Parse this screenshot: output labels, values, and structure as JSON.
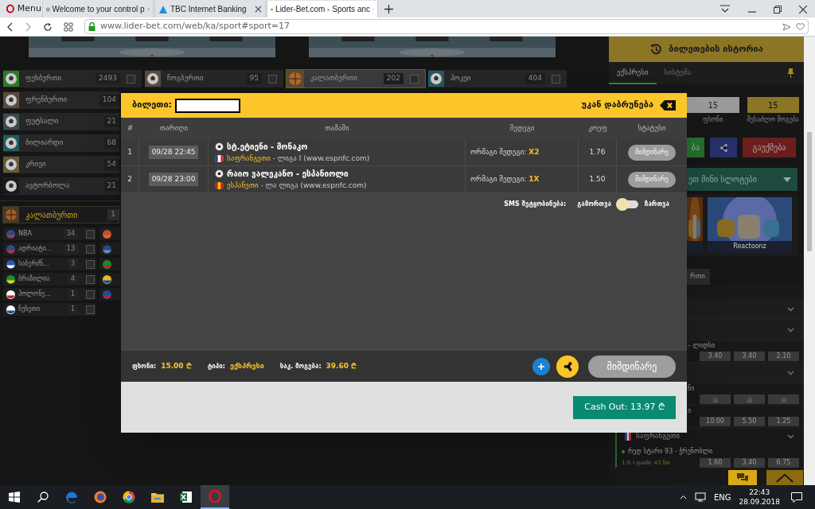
{
  "browser": {
    "menu": "Menu",
    "tabs": [
      {
        "label": "Welcome to your control p",
        "selected": false
      },
      {
        "label": "TBC Internet Banking",
        "selected": false
      },
      {
        "label": "Lider-Bet.com - Sports anc",
        "selected": true
      }
    ],
    "address": "www.lider-bet.com/web/ka/sport#sport=17"
  },
  "sports_top": [
    {
      "name": "ფეხბურთი",
      "count": "2493",
      "checked": false,
      "selected": false
    },
    {
      "name": "ჩოგბურთი",
      "count": "95",
      "checked": false,
      "selected": false
    },
    {
      "name": "კალათბურთი",
      "count": "202",
      "checked": false,
      "selected": true
    },
    {
      "name": "ჰოკეი",
      "count": "404",
      "checked": false,
      "selected": false
    }
  ],
  "sports_more": [
    {
      "name": "ფრენბურთი",
      "count": "104"
    },
    {
      "name": "ფუტსალი",
      "count": "21"
    },
    {
      "name": "ბილიარდი",
      "count": "68"
    },
    {
      "name": "კრივი",
      "count": "54"
    },
    {
      "name": "ავტორბოლა",
      "count": "21"
    }
  ],
  "active_sport": {
    "name": "კალათბურთი",
    "count": "1"
  },
  "leagues": [
    {
      "name": "NBA",
      "count": "34",
      "checked": false
    },
    {
      "name": "ადრიატი...",
      "count": "13",
      "checked": false
    },
    {
      "name": "საბერძნ...",
      "count": "3",
      "checked": false
    },
    {
      "name": "ბრაზილია",
      "count": "4",
      "checked": false
    },
    {
      "name": "პოლონე...",
      "count": "1",
      "checked": false
    },
    {
      "name": "ჩეხეთი",
      "count": "1",
      "checked": false
    }
  ],
  "betslip": {
    "history_button": "ბილეთების ისტორია",
    "tabs": [
      {
        "label": "ექსპრესი",
        "selected": true
      },
      {
        "label": "სისტემა",
        "selected": false
      }
    ],
    "stake": {
      "value": "15",
      "label": "ფსონი"
    },
    "possible_win": {
      "value": "15",
      "label": "შესაძლო მოგება"
    },
    "place_button": "ბა",
    "cancel_button": "გაუქმება"
  },
  "mini_slots": {
    "title": "ეთ მინი სლოტები",
    "games": [
      {
        "kind": "picture"
      },
      {
        "kind": "picture",
        "label": "Reactoonz"
      }
    ]
  },
  "events_tab": "რთი",
  "events": [
    {
      "kind": "collapsed"
    },
    {
      "kind": "collapsed"
    },
    {
      "kind": "match",
      "title": "– ლიდსი",
      "odds": [
        "3.40",
        "3.40",
        "2.10"
      ]
    },
    {
      "kind": "collapsed"
    },
    {
      "kind": "locked",
      "title": "ნი"
    },
    {
      "kind": "match",
      "title": "ი",
      "odds": [
        "10.00",
        "5.50",
        "1.25"
      ]
    },
    {
      "kind": "country",
      "title": "საფრანგეთი"
    },
    {
      "kind": "live",
      "title": "რედ სტარი 93 - ჭრენობლი",
      "score": "1:0",
      "period": "I ტაიმი",
      "minute": "43 წთ",
      "odds": [
        "1.60",
        "3.40",
        "6.75"
      ]
    }
  ],
  "ticket": {
    "label": "ბილეთი:",
    "back": "უკან დაბრუნება",
    "columns": [
      "#",
      "თარიღი",
      "თამაში",
      "შედეგი",
      "კოეფ",
      "სტატუსი"
    ],
    "bets": [
      {
        "index": "1",
        "date": "09/28 22:45",
        "match": "სტ.ეტიენი - მონაკო",
        "country": "საფრანგეთი",
        "league": "- ლიგა I (www.espnfc.com)",
        "market": "ორმაგი შედეგი:",
        "pick": "X2",
        "odds": "1.76",
        "status": "მიმდინარე"
      },
      {
        "index": "2",
        "date": "09/28 23:00",
        "match": "რაიო ვალეკანო - ესპანიოლი",
        "country": "ესპანეთი",
        "league": "- ლა ლიგა (www.espnfc.com)",
        "market": "ორმაგი შედეგი:",
        "pick": "1X",
        "odds": "1.50",
        "status": "მიმდინარე"
      }
    ],
    "sms": {
      "label": "SMS შეტყობინება:",
      "off": "გამორთვა",
      "on": "ჩართვა",
      "enabled": false
    },
    "summary": [
      {
        "label": "ფსონი:",
        "value": "15.00 ₾"
      },
      {
        "label": "ტიპი:",
        "value": "ექსპრესი"
      },
      {
        "label": "საკ. მოგება:",
        "value": "39.60 ₾"
      }
    ],
    "status_button": "მიმდინარე",
    "cash_out": "Cash Out: 13.97 ₾"
  },
  "taskbar": {
    "language": "ENG",
    "time": "22:43",
    "date": "28.09.2018"
  }
}
